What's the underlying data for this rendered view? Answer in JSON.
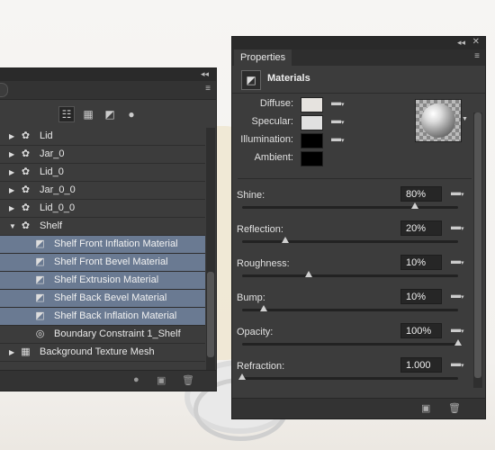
{
  "layers_panel": {
    "toolbar_icons": [
      "hierarchy-icon",
      "calculator-icon",
      "material-icon",
      "light-bulb-icon"
    ],
    "rows": [
      {
        "label": "Lid",
        "icon": "mesh-icon",
        "expanded": false,
        "indent": 0,
        "selected": false
      },
      {
        "label": "Jar_0",
        "icon": "mesh-icon",
        "expanded": false,
        "indent": 0,
        "selected": false
      },
      {
        "label": "Lid_0",
        "icon": "mesh-icon",
        "expanded": false,
        "indent": 0,
        "selected": false
      },
      {
        "label": "Jar_0_0",
        "icon": "mesh-icon",
        "expanded": false,
        "indent": 0,
        "selected": false
      },
      {
        "label": "Lid_0_0",
        "icon": "mesh-icon",
        "expanded": false,
        "indent": 0,
        "selected": false
      },
      {
        "label": "Shelf",
        "icon": "mesh-icon",
        "expanded": true,
        "indent": 0,
        "selected": false
      },
      {
        "label": "Shelf Front Inflation Material",
        "icon": "material-icon",
        "indent": 1,
        "selected": true
      },
      {
        "label": "Shelf Front Bevel Material",
        "icon": "material-icon",
        "indent": 1,
        "selected": true
      },
      {
        "label": "Shelf Extrusion Material",
        "icon": "material-icon",
        "indent": 1,
        "selected": true
      },
      {
        "label": "Shelf Back Bevel Material",
        "icon": "material-icon",
        "indent": 1,
        "selected": true
      },
      {
        "label": "Shelf Back Inflation Material",
        "icon": "material-icon",
        "indent": 1,
        "selected": true
      },
      {
        "label": "Boundary Constraint 1_Shelf",
        "icon": "constraint-icon",
        "indent": 1,
        "selected": false
      },
      {
        "label": "Background Texture Mesh",
        "icon": "texture-mesh-icon",
        "expanded": false,
        "indent": 0,
        "selected": false
      }
    ]
  },
  "properties_panel": {
    "tab": "Properties",
    "header_title": "Materials",
    "materials": [
      {
        "label": "Diffuse:",
        "color": "#e6e3df"
      },
      {
        "label": "Specular:",
        "color": "#e0e0e0"
      },
      {
        "label": "Illumination:",
        "color": "#000000"
      },
      {
        "label": "Ambient:",
        "color": "#000000"
      }
    ],
    "properties": [
      {
        "label": "Shine:",
        "value": "80%",
        "level": 0.8
      },
      {
        "label": "Reflection:",
        "value": "20%",
        "level": 0.2
      },
      {
        "label": "Roughness:",
        "value": "10%",
        "level": 0.31
      },
      {
        "label": "Bump:",
        "value": "10%",
        "level": 0.1
      },
      {
        "label": "Opacity:",
        "value": "100%",
        "level": 1.0
      },
      {
        "label": "Refraction:",
        "value": "1.000",
        "level": 0.0
      }
    ]
  }
}
